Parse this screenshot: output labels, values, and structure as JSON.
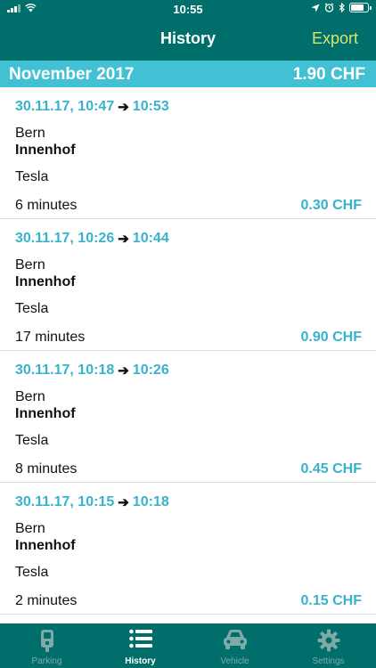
{
  "status_bar": {
    "time": "10:55"
  },
  "nav": {
    "title": "History",
    "export_label": "Export"
  },
  "month_header": {
    "month": "November 2017",
    "total": "1.90 CHF"
  },
  "entries": [
    {
      "start": "30.11.17, 10:47",
      "end": "10:53",
      "city": "Bern",
      "zone": "Innenhof",
      "vehicle": "Tesla",
      "duration": "6 minutes",
      "price": "0.30 CHF"
    },
    {
      "start": "30.11.17, 10:26",
      "end": "10:44",
      "city": "Bern",
      "zone": "Innenhof",
      "vehicle": "Tesla",
      "duration": "17 minutes",
      "price": "0.90 CHF"
    },
    {
      "start": "30.11.17, 10:18",
      "end": "10:26",
      "city": "Bern",
      "zone": "Innenhof",
      "vehicle": "Tesla",
      "duration": "8 minutes",
      "price": "0.45 CHF"
    },
    {
      "start": "30.11.17, 10:15",
      "end": "10:18",
      "city": "Bern",
      "zone": "Innenhof",
      "vehicle": "Tesla",
      "duration": "2 minutes",
      "price": "0.15 CHF"
    }
  ],
  "tabs": [
    {
      "label": "Parking",
      "icon": "parking-meter-icon",
      "active": false
    },
    {
      "label": "History",
      "icon": "list-icon",
      "active": true
    },
    {
      "label": "Vehicle",
      "icon": "car-icon",
      "active": false
    },
    {
      "label": "Settings",
      "icon": "gear-icon",
      "active": false
    }
  ],
  "colors": {
    "primary": "#006f6b",
    "accent": "#43c1d4",
    "accent_text": "#38b3cc",
    "export": "#d9e66a"
  }
}
